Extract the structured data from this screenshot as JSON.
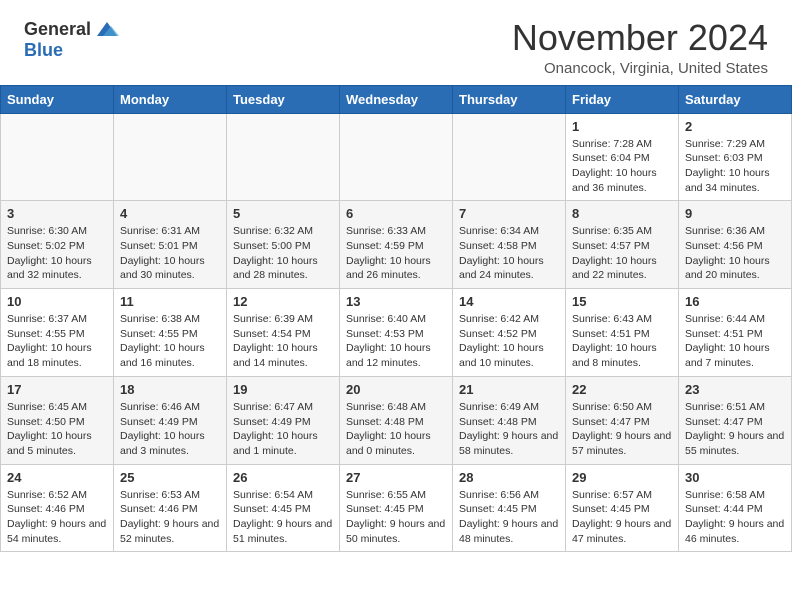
{
  "logo": {
    "general": "General",
    "blue": "Blue"
  },
  "header": {
    "month": "November 2024",
    "location": "Onancock, Virginia, United States"
  },
  "days_of_week": [
    "Sunday",
    "Monday",
    "Tuesday",
    "Wednesday",
    "Thursday",
    "Friday",
    "Saturday"
  ],
  "weeks": [
    [
      {
        "day": "",
        "info": ""
      },
      {
        "day": "",
        "info": ""
      },
      {
        "day": "",
        "info": ""
      },
      {
        "day": "",
        "info": ""
      },
      {
        "day": "",
        "info": ""
      },
      {
        "day": "1",
        "info": "Sunrise: 7:28 AM\nSunset: 6:04 PM\nDaylight: 10 hours and 36 minutes."
      },
      {
        "day": "2",
        "info": "Sunrise: 7:29 AM\nSunset: 6:03 PM\nDaylight: 10 hours and 34 minutes."
      }
    ],
    [
      {
        "day": "3",
        "info": "Sunrise: 6:30 AM\nSunset: 5:02 PM\nDaylight: 10 hours and 32 minutes."
      },
      {
        "day": "4",
        "info": "Sunrise: 6:31 AM\nSunset: 5:01 PM\nDaylight: 10 hours and 30 minutes."
      },
      {
        "day": "5",
        "info": "Sunrise: 6:32 AM\nSunset: 5:00 PM\nDaylight: 10 hours and 28 minutes."
      },
      {
        "day": "6",
        "info": "Sunrise: 6:33 AM\nSunset: 4:59 PM\nDaylight: 10 hours and 26 minutes."
      },
      {
        "day": "7",
        "info": "Sunrise: 6:34 AM\nSunset: 4:58 PM\nDaylight: 10 hours and 24 minutes."
      },
      {
        "day": "8",
        "info": "Sunrise: 6:35 AM\nSunset: 4:57 PM\nDaylight: 10 hours and 22 minutes."
      },
      {
        "day": "9",
        "info": "Sunrise: 6:36 AM\nSunset: 4:56 PM\nDaylight: 10 hours and 20 minutes."
      }
    ],
    [
      {
        "day": "10",
        "info": "Sunrise: 6:37 AM\nSunset: 4:55 PM\nDaylight: 10 hours and 18 minutes."
      },
      {
        "day": "11",
        "info": "Sunrise: 6:38 AM\nSunset: 4:55 PM\nDaylight: 10 hours and 16 minutes."
      },
      {
        "day": "12",
        "info": "Sunrise: 6:39 AM\nSunset: 4:54 PM\nDaylight: 10 hours and 14 minutes."
      },
      {
        "day": "13",
        "info": "Sunrise: 6:40 AM\nSunset: 4:53 PM\nDaylight: 10 hours and 12 minutes."
      },
      {
        "day": "14",
        "info": "Sunrise: 6:42 AM\nSunset: 4:52 PM\nDaylight: 10 hours and 10 minutes."
      },
      {
        "day": "15",
        "info": "Sunrise: 6:43 AM\nSunset: 4:51 PM\nDaylight: 10 hours and 8 minutes."
      },
      {
        "day": "16",
        "info": "Sunrise: 6:44 AM\nSunset: 4:51 PM\nDaylight: 10 hours and 7 minutes."
      }
    ],
    [
      {
        "day": "17",
        "info": "Sunrise: 6:45 AM\nSunset: 4:50 PM\nDaylight: 10 hours and 5 minutes."
      },
      {
        "day": "18",
        "info": "Sunrise: 6:46 AM\nSunset: 4:49 PM\nDaylight: 10 hours and 3 minutes."
      },
      {
        "day": "19",
        "info": "Sunrise: 6:47 AM\nSunset: 4:49 PM\nDaylight: 10 hours and 1 minute."
      },
      {
        "day": "20",
        "info": "Sunrise: 6:48 AM\nSunset: 4:48 PM\nDaylight: 10 hours and 0 minutes."
      },
      {
        "day": "21",
        "info": "Sunrise: 6:49 AM\nSunset: 4:48 PM\nDaylight: 9 hours and 58 minutes."
      },
      {
        "day": "22",
        "info": "Sunrise: 6:50 AM\nSunset: 4:47 PM\nDaylight: 9 hours and 57 minutes."
      },
      {
        "day": "23",
        "info": "Sunrise: 6:51 AM\nSunset: 4:47 PM\nDaylight: 9 hours and 55 minutes."
      }
    ],
    [
      {
        "day": "24",
        "info": "Sunrise: 6:52 AM\nSunset: 4:46 PM\nDaylight: 9 hours and 54 minutes."
      },
      {
        "day": "25",
        "info": "Sunrise: 6:53 AM\nSunset: 4:46 PM\nDaylight: 9 hours and 52 minutes."
      },
      {
        "day": "26",
        "info": "Sunrise: 6:54 AM\nSunset: 4:45 PM\nDaylight: 9 hours and 51 minutes."
      },
      {
        "day": "27",
        "info": "Sunrise: 6:55 AM\nSunset: 4:45 PM\nDaylight: 9 hours and 50 minutes."
      },
      {
        "day": "28",
        "info": "Sunrise: 6:56 AM\nSunset: 4:45 PM\nDaylight: 9 hours and 48 minutes."
      },
      {
        "day": "29",
        "info": "Sunrise: 6:57 AM\nSunset: 4:45 PM\nDaylight: 9 hours and 47 minutes."
      },
      {
        "day": "30",
        "info": "Sunrise: 6:58 AM\nSunset: 4:44 PM\nDaylight: 9 hours and 46 minutes."
      }
    ]
  ]
}
